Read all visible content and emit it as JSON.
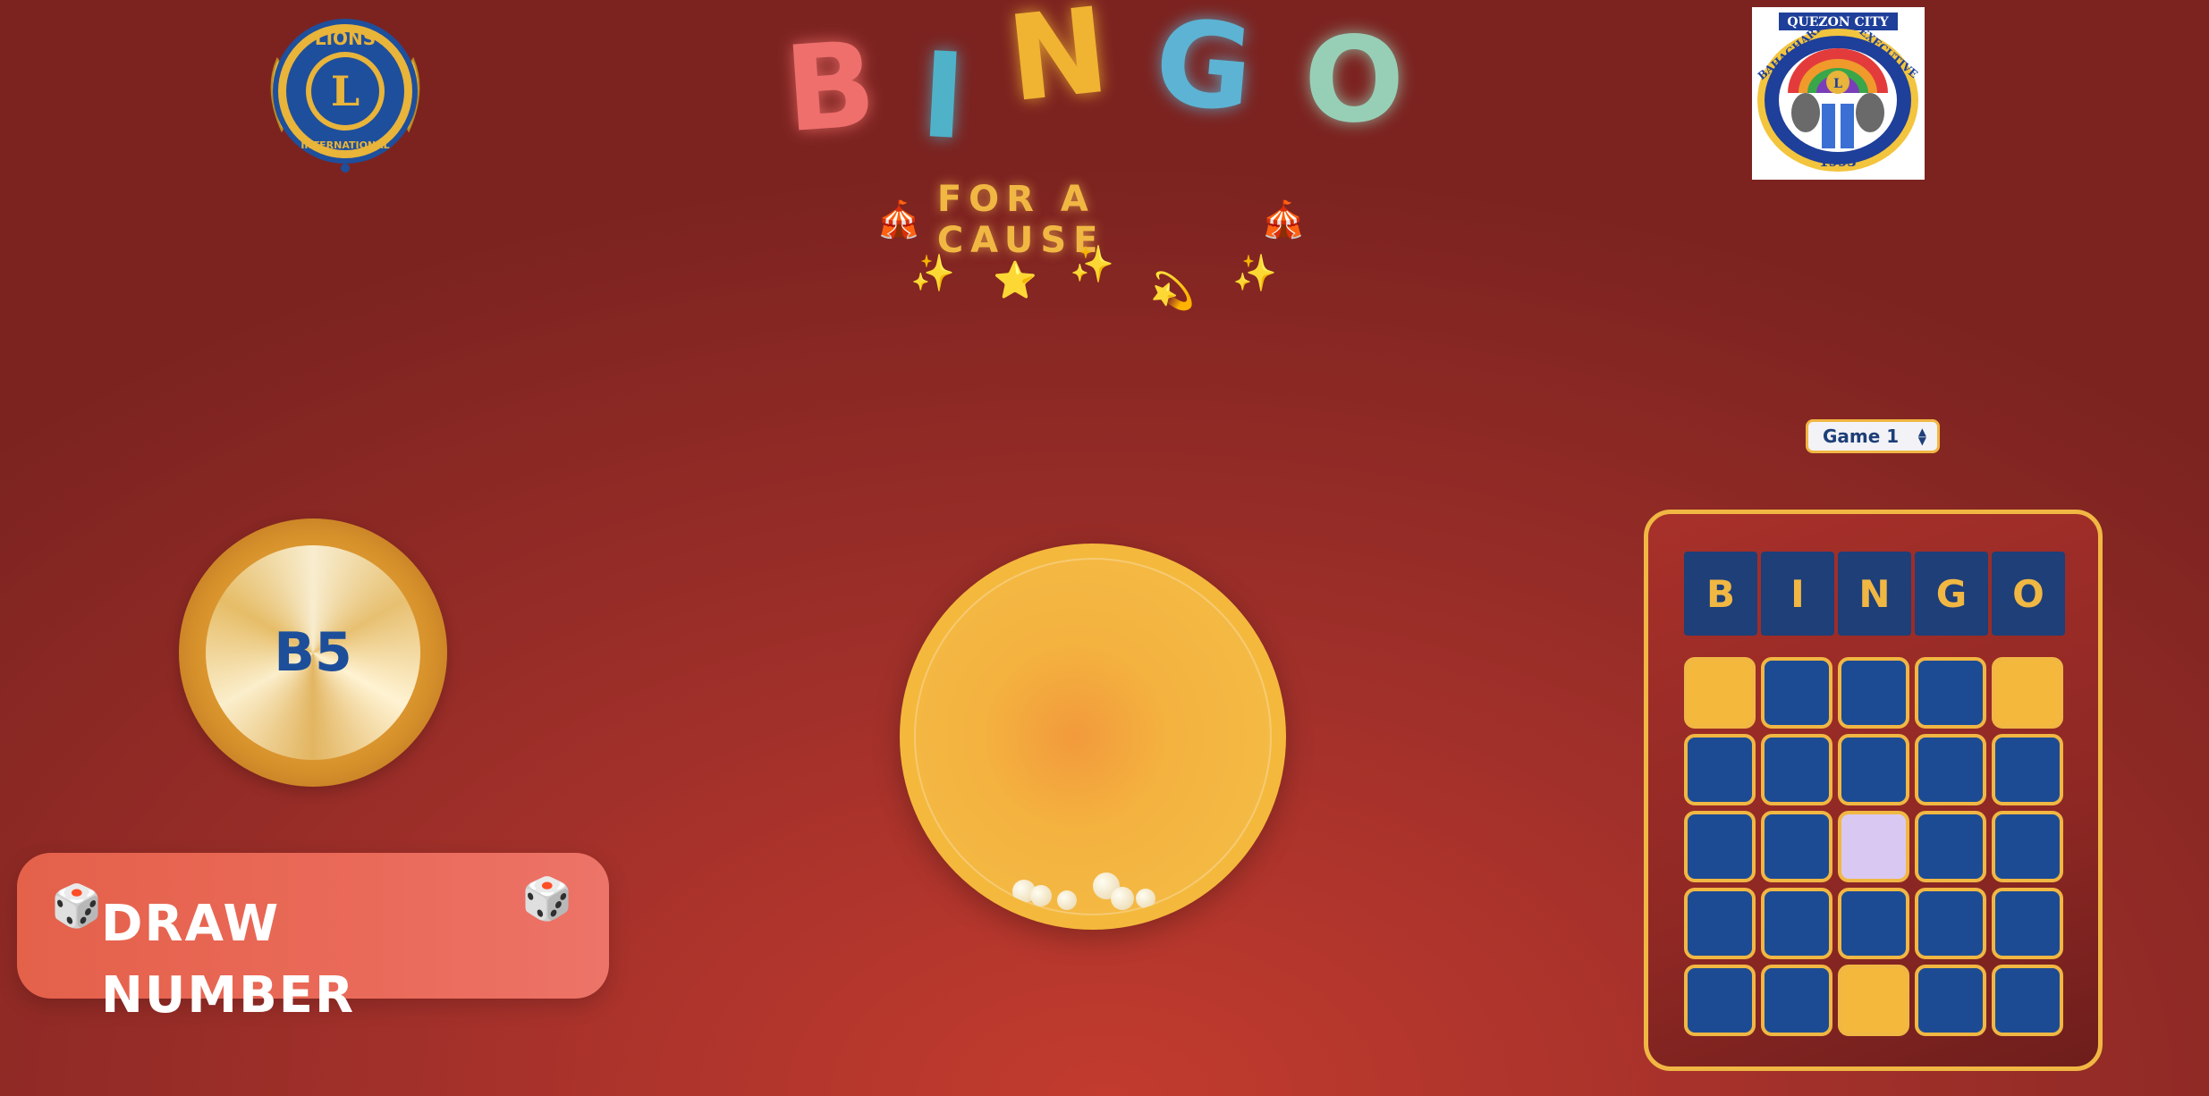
{
  "header": {
    "title_letters": [
      "B",
      "I",
      "N",
      "G",
      "O"
    ],
    "title_colors": [
      "#ee6f6c",
      "#4fb2c9",
      "#f0b432",
      "#5db3d3",
      "#97cfb6"
    ],
    "subtitle": "FOR A CAUSE",
    "subtitle_icon": "circus-tent-icon",
    "sparkle_icons": [
      "✨",
      "⭐",
      "✨",
      "💫",
      "✨"
    ]
  },
  "logos": {
    "left": {
      "icon": "lions-international-logo",
      "text_top": "LIONS",
      "letter": "L",
      "text_bottom": "INTERNATIONAL"
    },
    "right": {
      "icon": "club-logo",
      "text_top": "QUEZON CITY",
      "text_arc_left": "BAHAGHARI",
      "text_arc_right": "EXECUTIVE",
      "letter": "L",
      "year": "1993"
    }
  },
  "game_select": {
    "selected": "Game 1"
  },
  "current_ball": {
    "label": "B5"
  },
  "draw_button": {
    "label": "DRAW NUMBER",
    "icon": "dice-icon"
  },
  "card": {
    "headers": [
      "B",
      "I",
      "N",
      "G",
      "O"
    ],
    "cells": [
      [
        "gold",
        "blue",
        "blue",
        "blue",
        "gold"
      ],
      [
        "blue",
        "blue",
        "blue",
        "blue",
        "blue"
      ],
      [
        "blue",
        "blue",
        "marked",
        "blue",
        "blue"
      ],
      [
        "blue",
        "blue",
        "blue",
        "blue",
        "blue"
      ],
      [
        "blue",
        "blue",
        "gold",
        "blue",
        "blue"
      ]
    ],
    "colors": {
      "blue": "#1d4b93",
      "gold": "#f4b93c",
      "marked": "#d9c9f2",
      "border": "#f1b743"
    }
  },
  "colors": {
    "accent": "#f1b743",
    "background": "#a2302a",
    "button": "#e9685a"
  }
}
